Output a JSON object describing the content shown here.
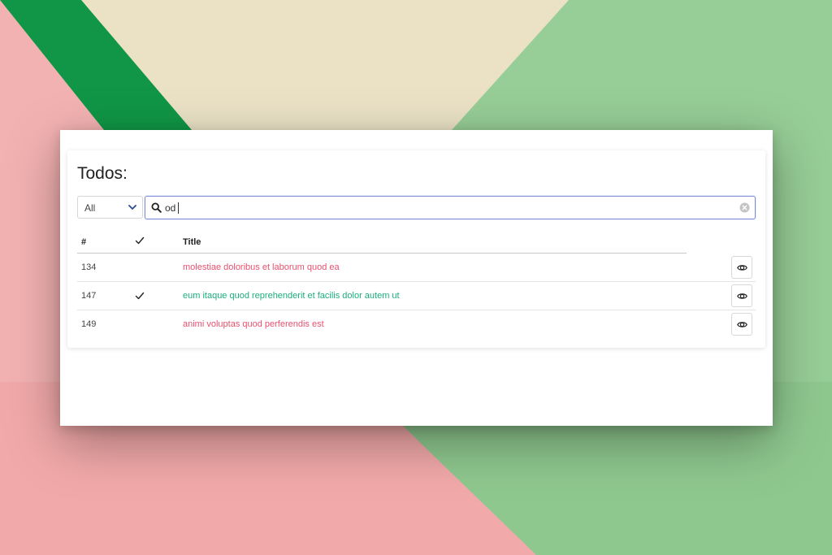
{
  "colors": {
    "pending_title": "#e8506e",
    "done_title": "#1bae7a",
    "search_border": "#7c8fd6",
    "chevron": "#2c4b9a"
  },
  "card": {
    "title": "Todos:"
  },
  "filter": {
    "selected": "All"
  },
  "search": {
    "value": "od",
    "icon": "search-icon",
    "clear_icon": "clear-circle-icon"
  },
  "table": {
    "headers": {
      "number": "#",
      "done_icon": "checkmark-icon",
      "title": "Title"
    },
    "rows": [
      {
        "id": "134",
        "done": false,
        "title": "molestiae doloribus et laborum quod ea"
      },
      {
        "id": "147",
        "done": true,
        "title": "eum itaque quod reprehenderit et facilis dolor autem ut"
      },
      {
        "id": "149",
        "done": false,
        "title": "animi voluptas quod perferendis est"
      }
    ],
    "row_action_icon": "eye-icon"
  }
}
